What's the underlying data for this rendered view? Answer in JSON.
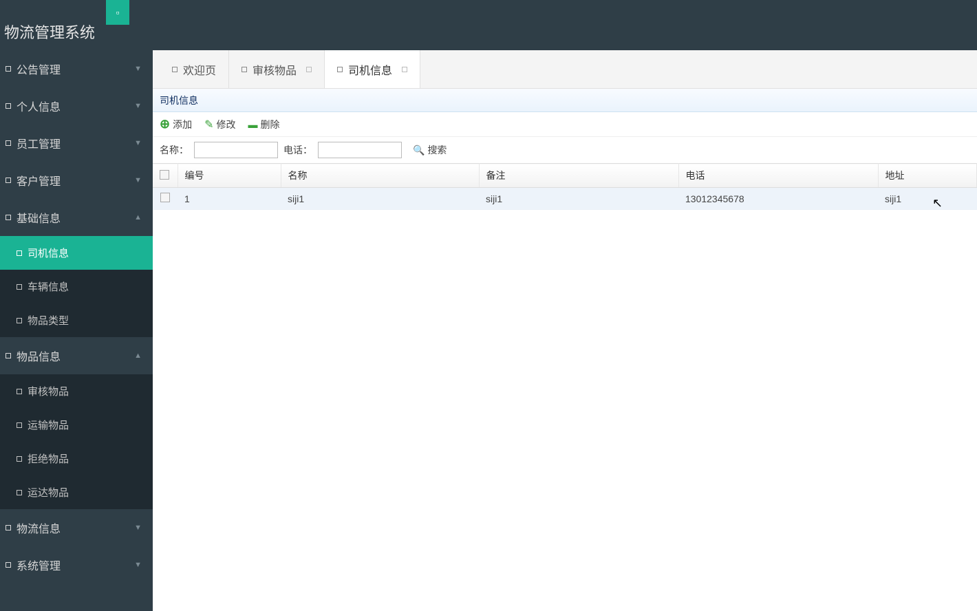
{
  "header": {
    "app_title": "物流管理系统"
  },
  "sidebar": {
    "items": [
      {
        "label": "公告管理",
        "expanded": false,
        "children": []
      },
      {
        "label": "个人信息",
        "expanded": false,
        "children": []
      },
      {
        "label": "员工管理",
        "expanded": false,
        "children": []
      },
      {
        "label": "客户管理",
        "expanded": false,
        "children": []
      },
      {
        "label": "基础信息",
        "expanded": true,
        "children": [
          {
            "label": "司机信息",
            "active": true
          },
          {
            "label": "车辆信息",
            "active": false
          },
          {
            "label": "物品类型",
            "active": false
          }
        ]
      },
      {
        "label": "物品信息",
        "expanded": true,
        "children": [
          {
            "label": "审核物品",
            "active": false
          },
          {
            "label": "运输物品",
            "active": false
          },
          {
            "label": "拒绝物品",
            "active": false
          },
          {
            "label": "运达物品",
            "active": false
          }
        ]
      },
      {
        "label": "物流信息",
        "expanded": false,
        "children": []
      },
      {
        "label": "系统管理",
        "expanded": false,
        "children": []
      }
    ]
  },
  "tabs": [
    {
      "label": "欢迎页",
      "closable": false,
      "active": false
    },
    {
      "label": "审核物品",
      "closable": true,
      "active": false
    },
    {
      "label": "司机信息",
      "closable": true,
      "active": true
    }
  ],
  "panel": {
    "title": "司机信息",
    "toolbar": {
      "add_label": "添加",
      "edit_label": "修改",
      "delete_label": "删除"
    },
    "search": {
      "name_label": "名称：",
      "phone_label": "电话：",
      "search_label": "搜索",
      "name_value": "",
      "phone_value": ""
    },
    "columns": [
      "编号",
      "名称",
      "备注",
      "电话",
      "地址"
    ],
    "rows": [
      {
        "id": "1",
        "name": "siji1",
        "note": "siji1",
        "phone": "13012345678",
        "address": "siji1"
      }
    ]
  }
}
